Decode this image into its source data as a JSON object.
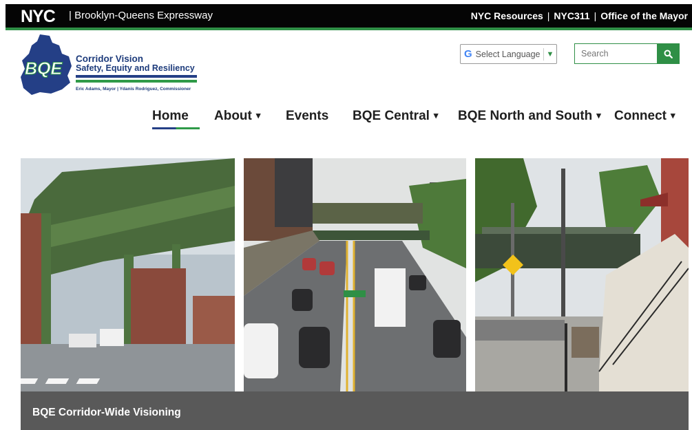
{
  "topbar": {
    "logo_text": "NYC",
    "site_name": "| Brooklyn-Queens Expressway",
    "links": [
      "NYC Resources",
      "NYC311",
      "Office of the Mayor"
    ],
    "separator": "|"
  },
  "logo": {
    "badge": "BQE",
    "title_line1": "Corridor Vision",
    "title_line2": "Safety, Equity and Resiliency",
    "subtitle": "Eric Adams, Mayor | Ydanis Rodriguez, Commissioner"
  },
  "translate": {
    "icon": "google-g-icon",
    "label": "Select Language"
  },
  "search": {
    "placeholder": "Search",
    "icon": "search-icon"
  },
  "nav": {
    "items": [
      {
        "label": "Home",
        "dropdown": false,
        "active": true
      },
      {
        "label": "About",
        "dropdown": true
      },
      {
        "label": "Events",
        "dropdown": false
      },
      {
        "label": "BQE Central",
        "dropdown": true
      },
      {
        "label": "BQE North and South",
        "dropdown": true
      },
      {
        "label": "Connect",
        "dropdown": true
      }
    ]
  },
  "hero": {
    "caption": "BQE Corridor-Wide Visioning"
  },
  "colors": {
    "brand_green": "#2f8f46",
    "brand_blue": "#1d3b7b",
    "topbar_bg": "#050505",
    "caption_bg": "#595959"
  }
}
